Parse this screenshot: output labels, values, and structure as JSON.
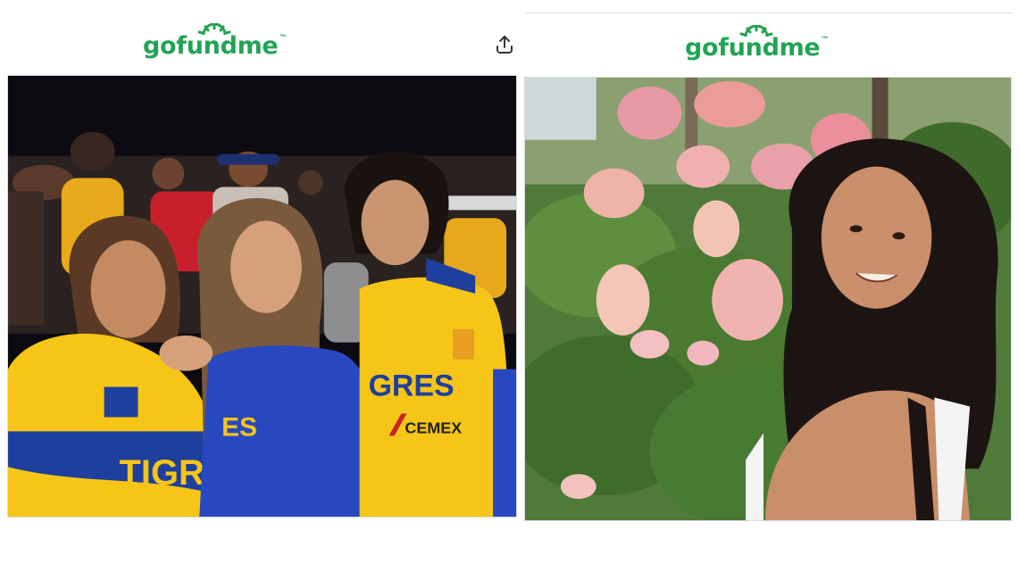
{
  "left_card": {
    "brand": "gofundme",
    "brand_tm": "™",
    "share_icon": "share-icon",
    "photo_alt": "Family at a Tigres soccer match"
  },
  "right_card": {
    "brand": "gofundme",
    "brand_tm": "™",
    "photo_alt": "Young woman smiling in front of hydrangea bushes"
  },
  "colors": {
    "brand_green": "#23a455",
    "jersey_yellow": "#f5c518",
    "jersey_blue": "#1f3f9e"
  },
  "jersey_text": {
    "sponsor": "GRES",
    "sponsor2": "CEMEX",
    "front": "TIGR",
    "front2": "ES"
  }
}
